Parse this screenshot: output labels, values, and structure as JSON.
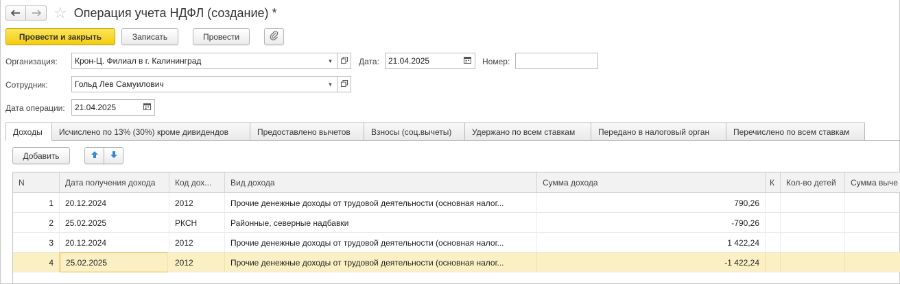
{
  "window": {
    "title": "Операция учета НДФЛ (создание) *",
    "back_icon": "arrow-left-icon",
    "forward_icon": "arrow-right-icon",
    "favorite_icon": "star-icon"
  },
  "toolbar": {
    "post_close_label": "Провести и закрыть",
    "save_label": "Записать",
    "post_label": "Провести",
    "attach_icon": "paperclip-icon"
  },
  "form": {
    "organization_label": "Организация:",
    "organization_value": "Крон-Ц. Филиал в г. Калининград",
    "date_label": "Дата:",
    "date_value": "21.04.2025",
    "number_label": "Номер:",
    "number_value": "",
    "employee_label": "Сотрудник:",
    "employee_value": "Гольд Лев Самуилович",
    "operation_date_label": "Дата операции:",
    "operation_date_value": "21.04.2025"
  },
  "tabs": [
    {
      "label": "Доходы",
      "active": true
    },
    {
      "label": "Исчислено по 13% (30%) кроме дивидендов",
      "active": false
    },
    {
      "label": "Предоставлено вычетов",
      "active": false
    },
    {
      "label": "Взносы (соц.вычеты)",
      "active": false
    },
    {
      "label": "Удержано по всем ставкам",
      "active": false
    },
    {
      "label": "Передано в налоговый орган",
      "active": false
    },
    {
      "label": "Перечислено по всем ставкам",
      "active": false
    }
  ],
  "table_toolbar": {
    "add_label": "Добавить",
    "up_icon": "arrow-up-icon",
    "down_icon": "arrow-down-icon"
  },
  "table": {
    "columns": [
      "N",
      "Дата получения дохода",
      "Код дох...",
      "Вид дохода",
      "Сумма дохода",
      "К",
      "Кол-во детей",
      "Сумма выче"
    ],
    "rows": [
      {
        "n": "1",
        "date": "20.12.2024",
        "code": "2012",
        "kind": "Прочие денежные доходы от трудовой деятельности (основная налог...",
        "sum": "790,26"
      },
      {
        "n": "2",
        "date": "25.02.2025",
        "code": "РКСН",
        "kind": "Районные, северные надбавки",
        "sum": "-790,26"
      },
      {
        "n": "3",
        "date": "20.12.2024",
        "code": "2012",
        "kind": "Прочие денежные доходы от трудовой деятельности (основная налог...",
        "sum": "1 422,24"
      },
      {
        "n": "4",
        "date": "25.02.2025",
        "code": "2012",
        "kind": "Прочие денежные доходы от трудовой деятельности (основная налог...",
        "sum": "-1 422,24"
      }
    ]
  },
  "colors": {
    "primary_button": "#f4cc0c",
    "selected_row": "#fbf0c4",
    "focus_border": "#e5b935",
    "arrow_blue": "#3b86d6"
  }
}
